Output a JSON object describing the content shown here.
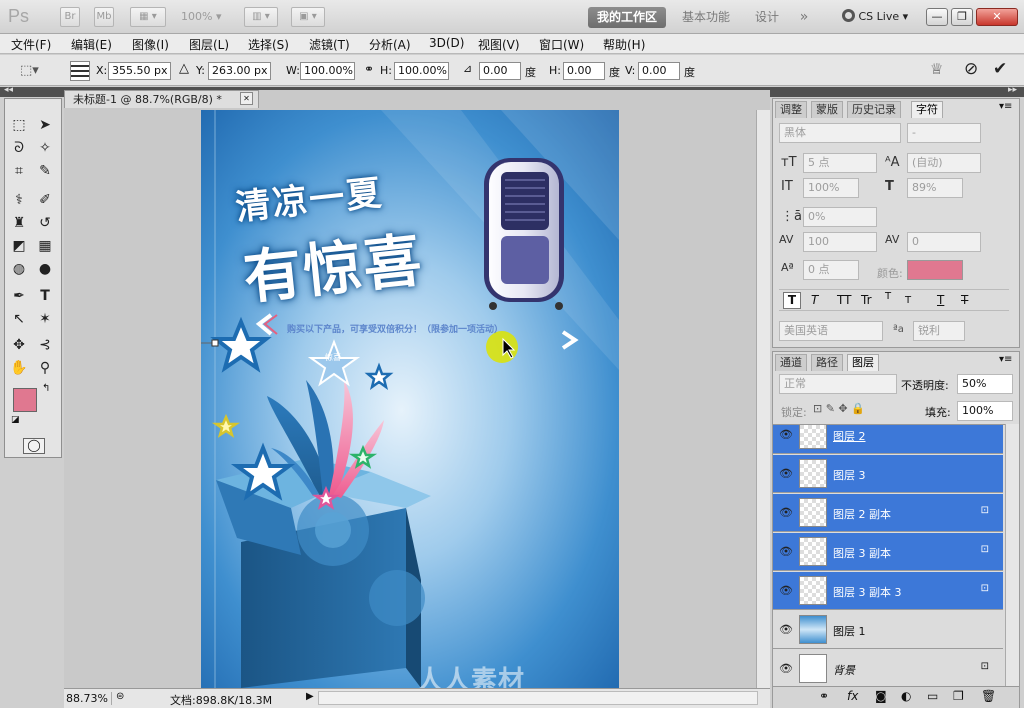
{
  "appbar": {
    "logo": "Ps",
    "bridge": "Br",
    "minibridge": "Mb",
    "zoom": "100%",
    "workspaces": [
      "我的工作区",
      "基本功能",
      "设计"
    ],
    "more": "»",
    "cs_live": "CS Live",
    "window_buttons": [
      "—",
      "❐",
      "✕"
    ]
  },
  "menubar": [
    "文件(F)",
    "编辑(E)",
    "图像(I)",
    "图层(L)",
    "选择(S)",
    "滤镜(T)",
    "分析(A)",
    "3D(D)",
    "视图(V)",
    "窗口(W)",
    "帮助(H)"
  ],
  "options": {
    "x_label": "X:",
    "x_value": "355.50 px",
    "y_label": "Y:",
    "y_value": "263.00 px",
    "w_label": "W:",
    "w_value": "100.00%",
    "h_label": "H:",
    "h_value": "100.00%",
    "angle_value": "0.00",
    "angle_unit": "度",
    "hskew_label": "H:",
    "hskew_value": "0.00",
    "hskew_unit": "度",
    "vskew_label": "V:",
    "vskew_value": "0.00",
    "vskew_unit": "度"
  },
  "document": {
    "tab_title": "未标题-1 @ 88.7%(RGB/8) *",
    "close": "✕",
    "zoom": "88.73%",
    "doc_info": "文档:898.8K/18.3M",
    "watermark": "人人素材"
  },
  "poster": {
    "headline1": "清凉一夏",
    "headline2": "有惊喜",
    "promo": "购买以下产品，可享受双倍积分！（限参加一项活动）",
    "badge": "惊喜"
  },
  "character_panel": {
    "tabs": [
      "调整",
      "蒙版",
      "历史记录",
      "字符"
    ],
    "font_family": "黑体",
    "font_style": "-",
    "size": "5 点",
    "leading": "(自动)",
    "vscale": "100%",
    "hscale": "89%",
    "kerning": "0%",
    "tracking": "100",
    "tracking2": "0",
    "baseline": "0 点",
    "color_label": "颜色:",
    "language": "美国英语",
    "aa_label": "a",
    "antialias": "锐利",
    "style_buttons": [
      "T",
      "T",
      "TT",
      "Tr",
      "T",
      "T",
      "T",
      "T"
    ]
  },
  "layers_panel": {
    "tabs": [
      "通道",
      "路径",
      "图层"
    ],
    "blend_mode": "正常",
    "opacity_label": "不透明度:",
    "opacity": "50%",
    "lock_label": "锁定:",
    "fill_label": "填充:",
    "fill": "100%",
    "layers": [
      {
        "name": "图层 2",
        "selected": true,
        "locked": false
      },
      {
        "name": "图层 3",
        "selected": true,
        "locked": false
      },
      {
        "name": "图层 2 副本",
        "selected": true,
        "locked": true
      },
      {
        "name": "图层 3 副本",
        "selected": true,
        "locked": true
      },
      {
        "name": "图层 3 副本 3",
        "selected": true,
        "locked": true
      },
      {
        "name": "图层 1",
        "selected": false,
        "locked": false
      },
      {
        "name": "背景",
        "selected": false,
        "locked": true
      }
    ]
  },
  "colors": {
    "foreground": "#e07890",
    "background": "#111111",
    "text_color": "#e07890",
    "selection": "#3d78d8"
  }
}
